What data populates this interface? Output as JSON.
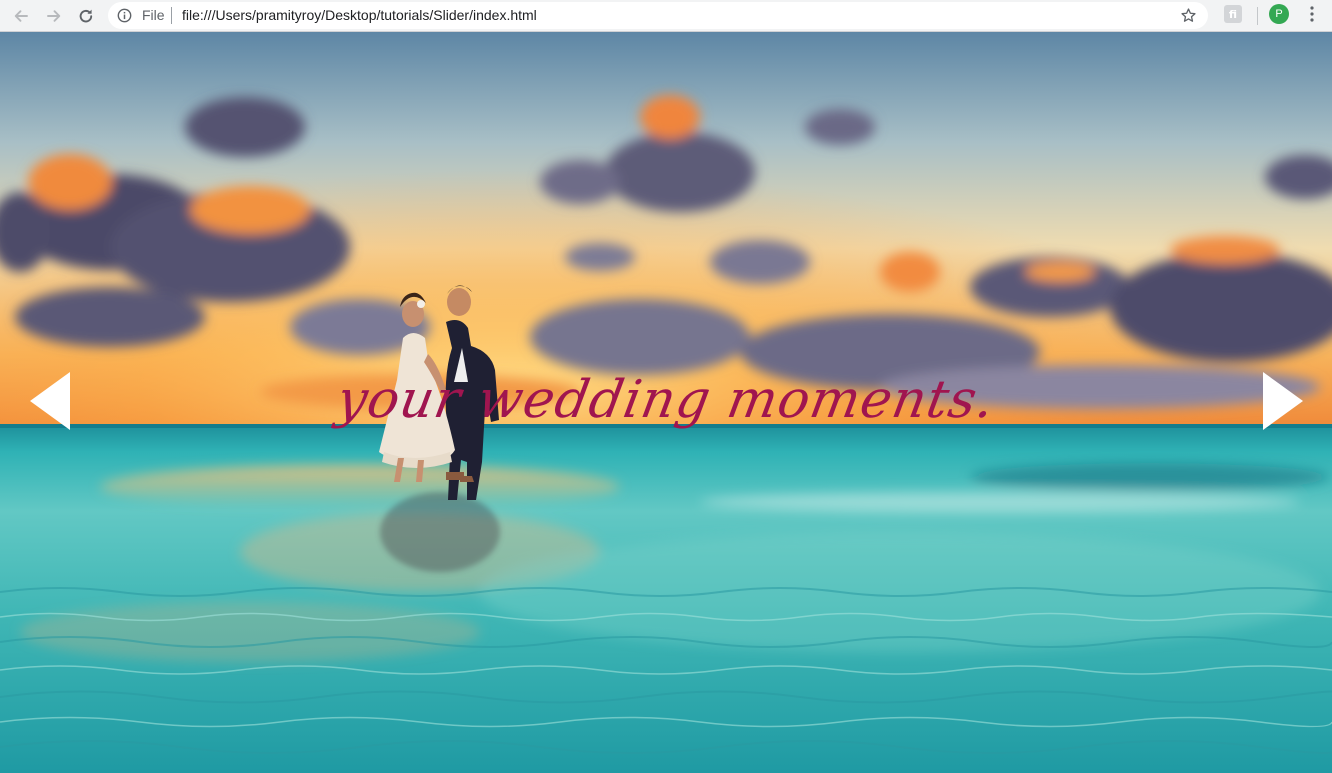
{
  "browser": {
    "scheme_label": "File",
    "url": "file:///Users/pramityroy/Desktop/tutorials/Slider/index.html",
    "extension_label": "fi",
    "profile_initial": "P",
    "icons": {
      "back": "arrow-left-icon",
      "forward": "arrow-right-icon",
      "reload": "reload-icon",
      "info": "info-icon",
      "bookmark": "star-icon",
      "menu": "kebab-menu-icon"
    }
  },
  "slider": {
    "caption": "your wedding moments.",
    "caption_color": "#a0154f",
    "arrow_color": "#ffffff",
    "prev_icon": "triangle-left-icon",
    "next_icon": "triangle-right-icon"
  }
}
